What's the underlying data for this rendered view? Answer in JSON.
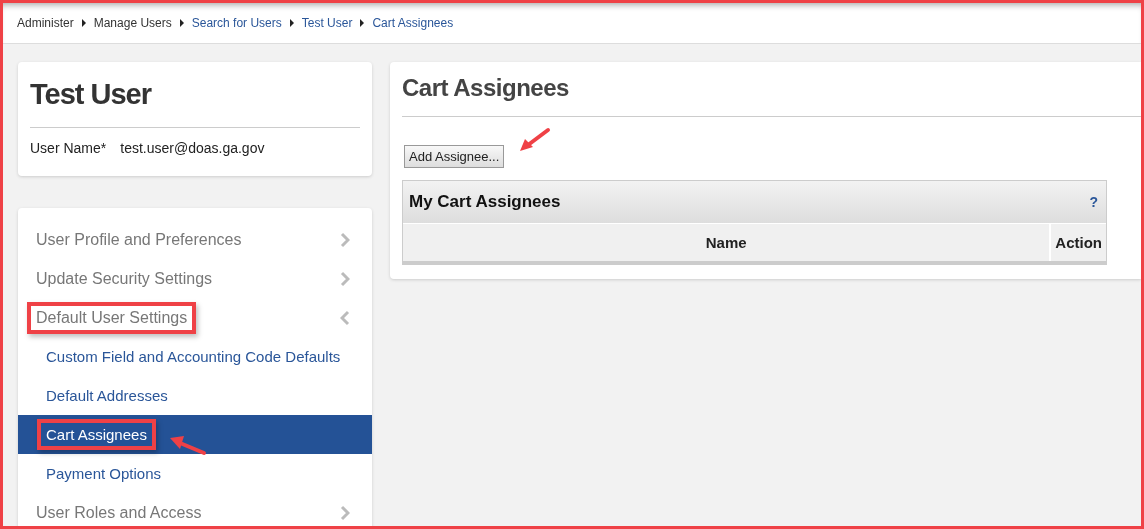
{
  "breadcrumb": [
    {
      "label": "Administer",
      "link": false
    },
    {
      "label": "Manage Users",
      "link": false
    },
    {
      "label": "Search for Users",
      "link": true
    },
    {
      "label": "Test User",
      "link": true
    },
    {
      "label": "Cart Assignees",
      "link": true
    }
  ],
  "user": {
    "name": "Test User",
    "field_label": "User Name*",
    "field_value": "test.user@doas.ga.gov"
  },
  "nav": [
    {
      "label": "User Profile and Preferences",
      "expanded": false,
      "highlighted": false
    },
    {
      "label": "Update Security Settings",
      "expanded": false,
      "highlighted": false
    },
    {
      "label": "Default User Settings",
      "expanded": true,
      "highlighted": true,
      "children": [
        {
          "label": "Custom Field and Accounting Code Defaults",
          "selected": false,
          "highlighted": false,
          "arrow": false
        },
        {
          "label": "Default Addresses",
          "selected": false,
          "highlighted": false,
          "arrow": false
        },
        {
          "label": "Cart Assignees",
          "selected": true,
          "highlighted": true,
          "arrow": true
        },
        {
          "label": "Payment Options",
          "selected": false,
          "highlighted": false,
          "arrow": false
        }
      ]
    },
    {
      "label": "User Roles and Access",
      "expanded": false,
      "highlighted": false
    }
  ],
  "main": {
    "title": "Cart Assignees",
    "button": {
      "label": "Add Assignee...",
      "arrow": true
    },
    "table": {
      "title": "My Cart Assignees",
      "help": "?",
      "columns": [
        "Name",
        "Action"
      ]
    }
  }
}
